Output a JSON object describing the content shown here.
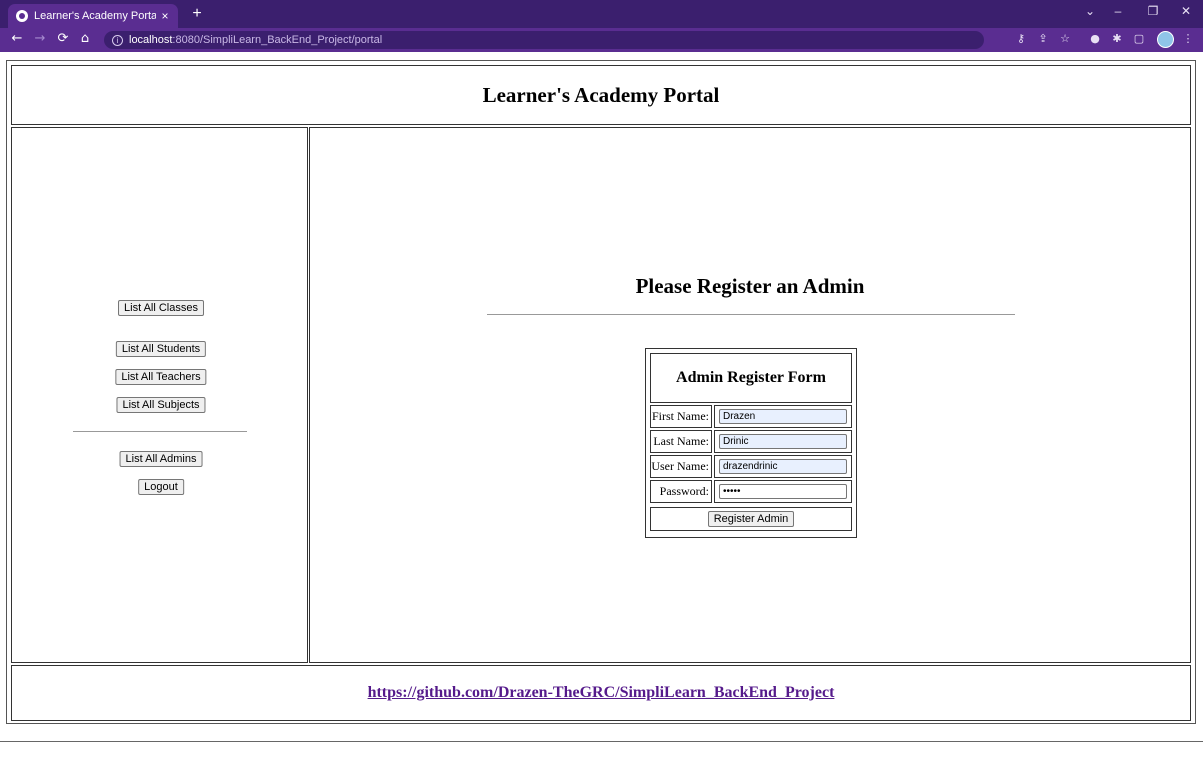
{
  "browser": {
    "tab_title": "Learner's Academy Portal",
    "tab_close": "×",
    "new_tab": "+",
    "url_host": "localhost",
    "url_path": ":8080/SimpliLearn_BackEnd_Project/portal",
    "window_controls": [
      "⌄",
      "–",
      "❐",
      "✕"
    ],
    "nav": {
      "back": "←",
      "forward": "→",
      "reload": "⟳",
      "home": "⌂"
    },
    "toolbar_icons": [
      "key-icon",
      "share-icon",
      "star-icon",
      "extension-color-icon",
      "puzzle-icon",
      "sidepanel-icon"
    ],
    "accent_color": "#5a2d91"
  },
  "page": {
    "header_title": "Learner's Academy Portal",
    "menu": {
      "list_classes": "List All Classes",
      "list_students": "List All Students",
      "list_teachers": "List All Teachers",
      "list_subjects": "List All Subjects",
      "list_admins": "List All Admins",
      "logout": "Logout"
    },
    "main_title": "Please Register an Admin",
    "form": {
      "title": "Admin Register Form",
      "first_name_label": "First Name:",
      "first_name_value": "Drazen",
      "last_name_label": "Last Name:",
      "last_name_value": "Drinic",
      "user_name_label": "User Name:",
      "user_name_value": "drazendrinic",
      "password_label": "Password:",
      "password_value": "•••••",
      "submit_label": "Register Admin"
    },
    "footer_link": "https://github.com/Drazen-TheGRC/SimpliLearn_BackEnd_Project",
    "link_color": "#551a8b"
  }
}
